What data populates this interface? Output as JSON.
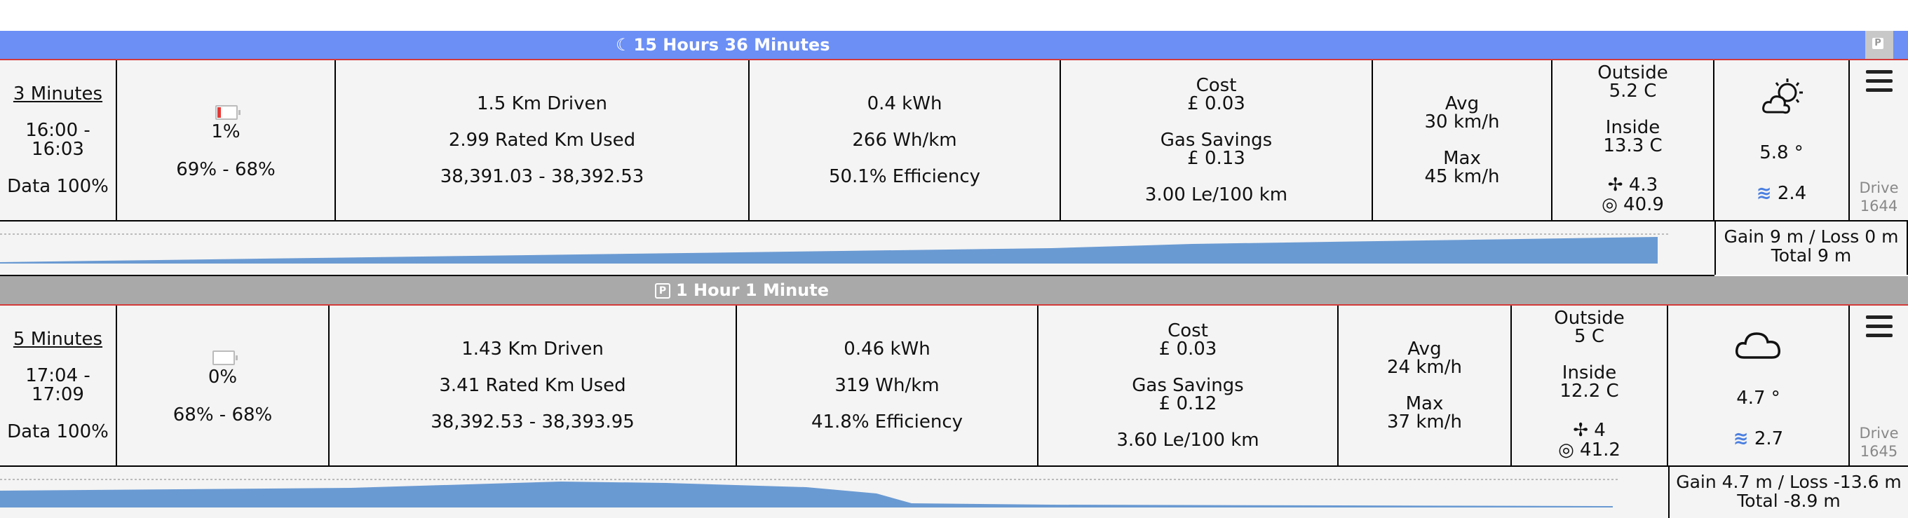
{
  "sleep_bar": {
    "duration": "15 Hours 36 Minutes",
    "corner_badge": "P"
  },
  "drives": [
    {
      "duration": "3 Minutes",
      "time_start": "16:00 -",
      "time_end": "16:03",
      "data": "Data 100%",
      "battery_used": "1%",
      "battery_range": "69% - 68%",
      "battery_level": 0.69,
      "km_driven": "1.5 Km Driven",
      "rated_used": "2.99 Rated Km Used",
      "odometer": "38,391.03 - 38,392.53",
      "kwh": "0.4 kWh",
      "wh_km": "266 Wh/km",
      "efficiency": "50.1% Efficiency",
      "cost_label": "Cost",
      "cost": "£ 0.03",
      "gas_label": "Gas Savings",
      "gas": "£ 0.13",
      "le": "3.00 Le/100 km",
      "avg_label": "Avg",
      "avg": "30 km/h",
      "max_label": "Max",
      "max": "45 km/h",
      "outside_label": "Outside",
      "outside": "5.2 C",
      "inside_label": "Inside",
      "inside": "13.3 C",
      "fan": "4.3",
      "tire": "40.9",
      "weather_icon": "partly-cloudy-night-icon",
      "temp": "5.8 °",
      "wind": "2.4",
      "drive_label": "Drive",
      "drive_id": "1644",
      "elevation": {
        "line1": "Gain 9 m / Loss 0 m",
        "line2": "Total 9 m"
      }
    },
    {
      "duration": "5 Minutes",
      "time_start": "17:04 -",
      "time_end": "17:09",
      "data": "Data 100%",
      "battery_used": "0%",
      "battery_range": "68% - 68%",
      "battery_level": 0.68,
      "km_driven": "1.43 Km Driven",
      "rated_used": "3.41 Rated Km Used",
      "odometer": "38,392.53 - 38,393.95",
      "kwh": "0.46 kWh",
      "wh_km": "319 Wh/km",
      "efficiency": "41.8% Efficiency",
      "cost_label": "Cost",
      "cost": "£ 0.03",
      "gas_label": "Gas Savings",
      "gas": "£ 0.12",
      "le": "3.60 Le/100 km",
      "avg_label": "Avg",
      "avg": "24 km/h",
      "max_label": "Max",
      "max": "37 km/h",
      "outside_label": "Outside",
      "outside": "5 C",
      "inside_label": "Inside",
      "inside": "12.2 C",
      "fan": "4",
      "tire": "41.2",
      "weather_icon": "cloud-icon",
      "temp": "4.7 °",
      "wind": "2.7",
      "drive_label": "Drive",
      "drive_id": "1645",
      "elevation": {
        "line1": "Gain 4.7 m / Loss -13.6 m",
        "line2": "Total -8.9 m"
      }
    }
  ],
  "park_bar": {
    "duration": "1 Hour 1 Minute"
  },
  "colors": {
    "sleep_bar": "#6b8ff5",
    "park_bar": "#a9a9a9",
    "elevation_fill": "#6a9ad2",
    "wind": "#4a7fe0"
  }
}
